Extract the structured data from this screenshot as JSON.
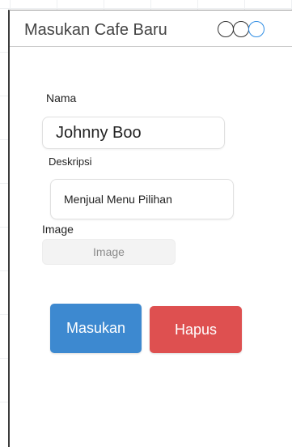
{
  "window": {
    "title": "Masukan Cafe Baru",
    "controls": [
      "close-circle-icon",
      "minimize-circle-icon",
      "maximize-circle-icon"
    ]
  },
  "form": {
    "name_label": "Nama",
    "name_value": "Johnny Boo",
    "description_label": "Deskripsi",
    "description_value": "Menjual Menu Pilihan",
    "image_label": "Image",
    "image_placeholder": "Image"
  },
  "actions": {
    "submit_label": "Masukan",
    "delete_label": "Hapus"
  },
  "colors": {
    "submit": "#3d89d0",
    "delete": "#de5050",
    "active_control": "#2f8de4"
  }
}
